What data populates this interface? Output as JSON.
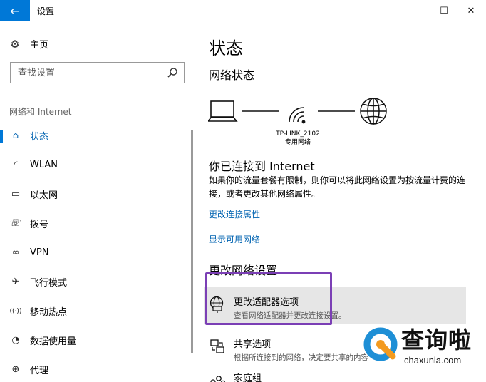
{
  "window": {
    "title": "设置",
    "back_glyph": "←",
    "minimize_glyph": "—",
    "maximize_glyph": "☐",
    "close_glyph": "✕",
    "accent": "#0078d7"
  },
  "sidebar": {
    "home_label": "主页",
    "search_placeholder": "查找设置",
    "section_label": "网络和 Internet",
    "items": [
      {
        "label": "状态",
        "icon": "home-status-icon",
        "glyph": "⌂",
        "active": true
      },
      {
        "label": "WLAN",
        "icon": "wifi-icon",
        "glyph": "◜",
        "active": false
      },
      {
        "label": "以太网",
        "icon": "ethernet-icon",
        "glyph": "▭",
        "active": false
      },
      {
        "label": "拨号",
        "icon": "dialup-icon",
        "glyph": "☏",
        "active": false
      },
      {
        "label": "VPN",
        "icon": "vpn-icon",
        "glyph": "∞",
        "active": false
      },
      {
        "label": "飞行模式",
        "icon": "airplane-icon",
        "glyph": "✈",
        "active": false
      },
      {
        "label": "移动热点",
        "icon": "hotspot-icon",
        "glyph": "((·))",
        "active": false
      },
      {
        "label": "数据使用量",
        "icon": "data-usage-icon",
        "glyph": "◔",
        "active": false
      },
      {
        "label": "代理",
        "icon": "proxy-icon",
        "glyph": "⊕",
        "active": false
      }
    ]
  },
  "main": {
    "page_title": "状态",
    "network_status_title": "网络状态",
    "network_name": "TP-LINK_2102",
    "network_type": "专用网络",
    "connected_title": "你已连接到 Internet",
    "connected_desc": "如果你的流量套餐有限制，则你可以将此网络设置为按流量计费的连接，或者更改其他网络属性。",
    "link_change_props": "更改连接属性",
    "link_show_networks": "显示可用网络",
    "change_settings_title": "更改网络设置",
    "options": [
      {
        "name": "更改适配器选项",
        "desc": "查看网络适配器并更改连接设置。",
        "icon": "adapter-icon"
      },
      {
        "name": "共享选项",
        "desc": "根据所连接到的网络，决定要共享的内容",
        "icon": "sharing-icon"
      },
      {
        "name": "家庭组",
        "desc": "",
        "icon": "homegroup-icon"
      }
    ],
    "highlight_color": "#7b3fb5",
    "link_color": "#0063b1"
  },
  "watermark": {
    "text": "查询啦",
    "url": "chaxunla.com",
    "colors": {
      "blue": "#1e8fd6",
      "orange": "#f39a1e"
    }
  }
}
